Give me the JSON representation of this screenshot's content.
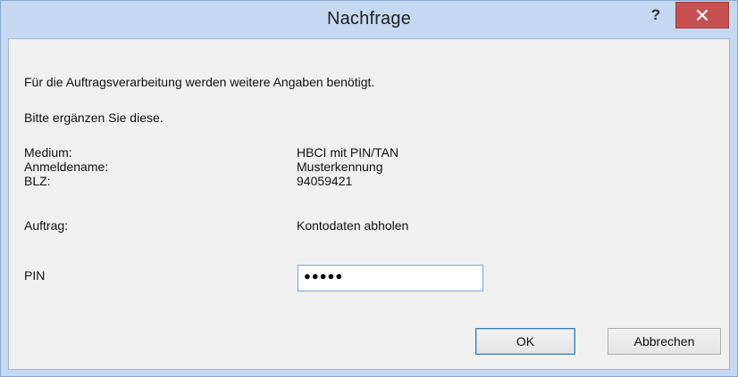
{
  "dialog": {
    "title": "Nachfrage",
    "help_label": "?",
    "close_label": "×"
  },
  "message": {
    "line1": "Für die Auftragsverarbeitung werden weitere Angaben benötigt.",
    "line2": "Bitte ergänzen Sie diese."
  },
  "info": {
    "medium_label": "Medium:",
    "medium_value": "HBCI mit PIN/TAN",
    "login_label": "Anmeldename:",
    "login_value": "Musterkennung",
    "blz_label": "BLZ:",
    "blz_value": "94059421",
    "order_label": "Auftrag:",
    "order_value": "Kontodaten abholen"
  },
  "pin": {
    "label": "PIN",
    "value": "●●●●●"
  },
  "buttons": {
    "ok": "OK",
    "cancel": "Abbrechen"
  },
  "colors": {
    "title_bar": "#c4d9f1",
    "close_button": "#c75050",
    "client_bg": "#f0f0f0",
    "input_border": "#7aa7d6"
  }
}
